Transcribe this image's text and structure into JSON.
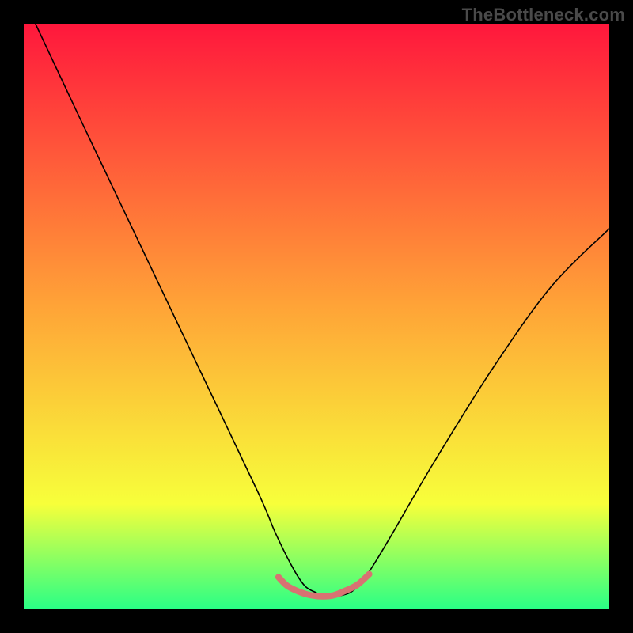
{
  "watermark": "TheBottleneck.com",
  "colors": {
    "red": "#ff173c",
    "orange": "#ffa337",
    "yellow": "#f7ff3a",
    "green": "#29ff86",
    "curve": "#000000",
    "flat": "#d87272"
  },
  "chart_data": {
    "type": "line",
    "title": "",
    "xlabel": "",
    "ylabel": "",
    "xlim": [
      0,
      100
    ],
    "ylim": [
      0,
      100
    ],
    "grid": false,
    "legend": false,
    "annotations": [],
    "series": [
      {
        "name": "curve",
        "x": [
          2,
          10,
          20,
          30,
          40,
          43,
          46,
          48,
          50,
          52,
          54,
          56,
          58,
          60,
          63,
          70,
          80,
          90,
          100
        ],
        "values": [
          100,
          83,
          62,
          41,
          20,
          13,
          7,
          4,
          2.8,
          2,
          2.3,
          3,
          5,
          8,
          13,
          25,
          41,
          55,
          65
        ]
      },
      {
        "name": "flat_band",
        "x": [
          43.5,
          45,
          47,
          49,
          51,
          53,
          55,
          57,
          59
        ],
        "values": [
          5.5,
          4,
          3,
          2.4,
          2.2,
          2.4,
          3.2,
          4.2,
          6
        ]
      }
    ]
  }
}
